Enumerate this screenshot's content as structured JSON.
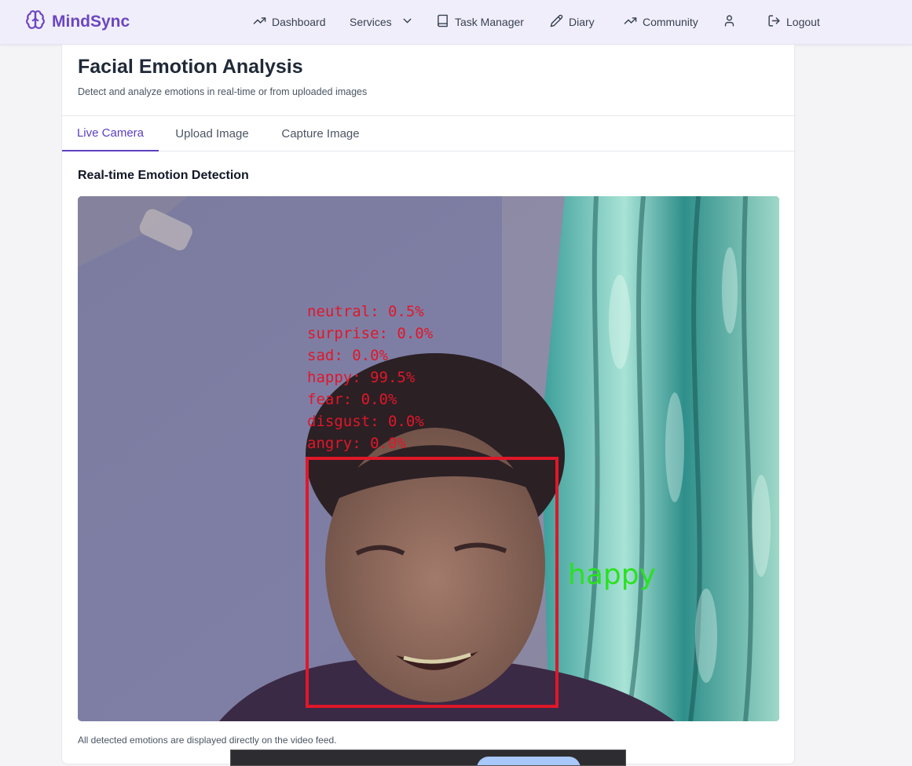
{
  "app": {
    "brand_name": "MindSync",
    "brand_color": "#6b46c1"
  },
  "nav": {
    "dashboard": "Dashboard",
    "services": "Services",
    "task_manager": "Task Manager",
    "diary": "Diary",
    "community": "Community",
    "logout": "Logout"
  },
  "page": {
    "title": "Facial Emotion Analysis",
    "subtitle": "Detect and analyze emotions in real-time or from uploaded images"
  },
  "tabs": [
    {
      "label": "Live Camera",
      "active": true
    },
    {
      "label": "Upload Image",
      "active": false
    },
    {
      "label": "Capture Image",
      "active": false
    }
  ],
  "section": {
    "title": "Real-time Emotion Detection",
    "note": "All detected emotions are displayed directly on the video feed."
  },
  "detection": {
    "dominant_label": "happy",
    "scores": [
      "neutral: 0.5%",
      "surprise: 0.0%",
      "sad: 0.0%",
      "happy: 99.5%",
      "fear: 0.0%",
      "disgust: 0.0%",
      "angry: 0.0%"
    ],
    "box_color": "#e0172a",
    "label_color": "#29e21e"
  },
  "icons": {
    "brand": "brain-icon",
    "dashboard": "trending-up-icon",
    "services": "chevron-down-icon",
    "task_manager": "book-icon",
    "diary": "pencil-icon",
    "community": "trending-up-icon",
    "profile": "user-icon",
    "logout": "logout-icon"
  }
}
